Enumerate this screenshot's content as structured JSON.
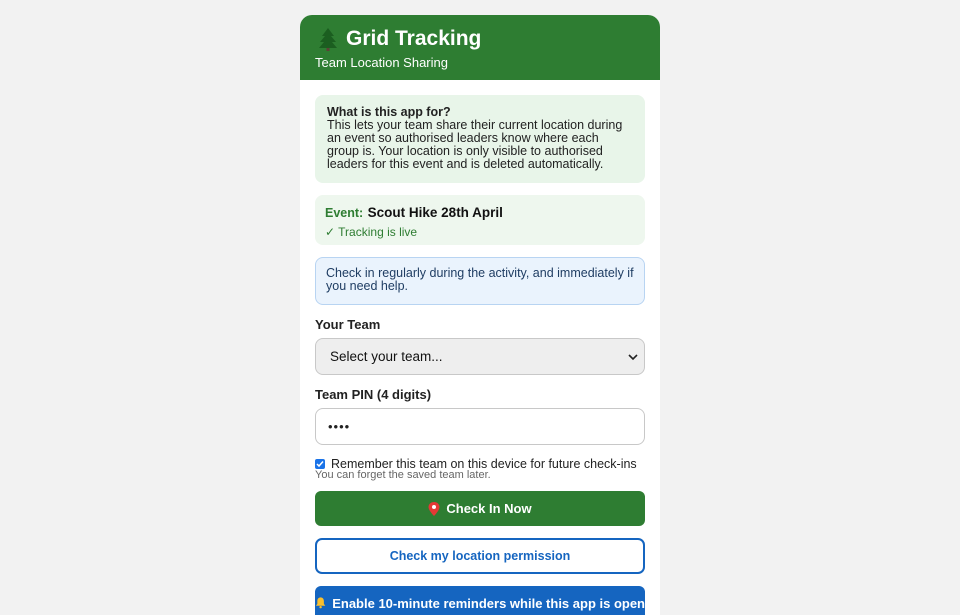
{
  "header": {
    "title": "Grid Tracking",
    "subtitle": "Team Location Sharing",
    "icon": "tree-icon"
  },
  "info": {
    "title": "What is this app for?",
    "body": "This lets your team share their current location during an event so authorised leaders know where each group is. Your location is only visible to authorised leaders for this event and is deleted automatically."
  },
  "event": {
    "label": "Event:",
    "name": "Scout Hike 28th April",
    "status": "✓ Tracking is live"
  },
  "notice": {
    "text": "Check in regularly during the activity, and immediately if you need help."
  },
  "team": {
    "label": "Your Team",
    "selected": "Select your team..."
  },
  "pin": {
    "label": "Team PIN (4 digits)",
    "value": "••••"
  },
  "remember": {
    "label": "Remember this team on this device for future check-ins",
    "checked": true,
    "hint": "You can forget the saved team later."
  },
  "buttons": {
    "check_in": "Check In Now",
    "check_permission": "Check my location permission",
    "reminders": "Enable 10-minute reminders while this app is open"
  },
  "colors": {
    "brand_green": "#2e7d32",
    "link_blue": "#1565c0"
  }
}
